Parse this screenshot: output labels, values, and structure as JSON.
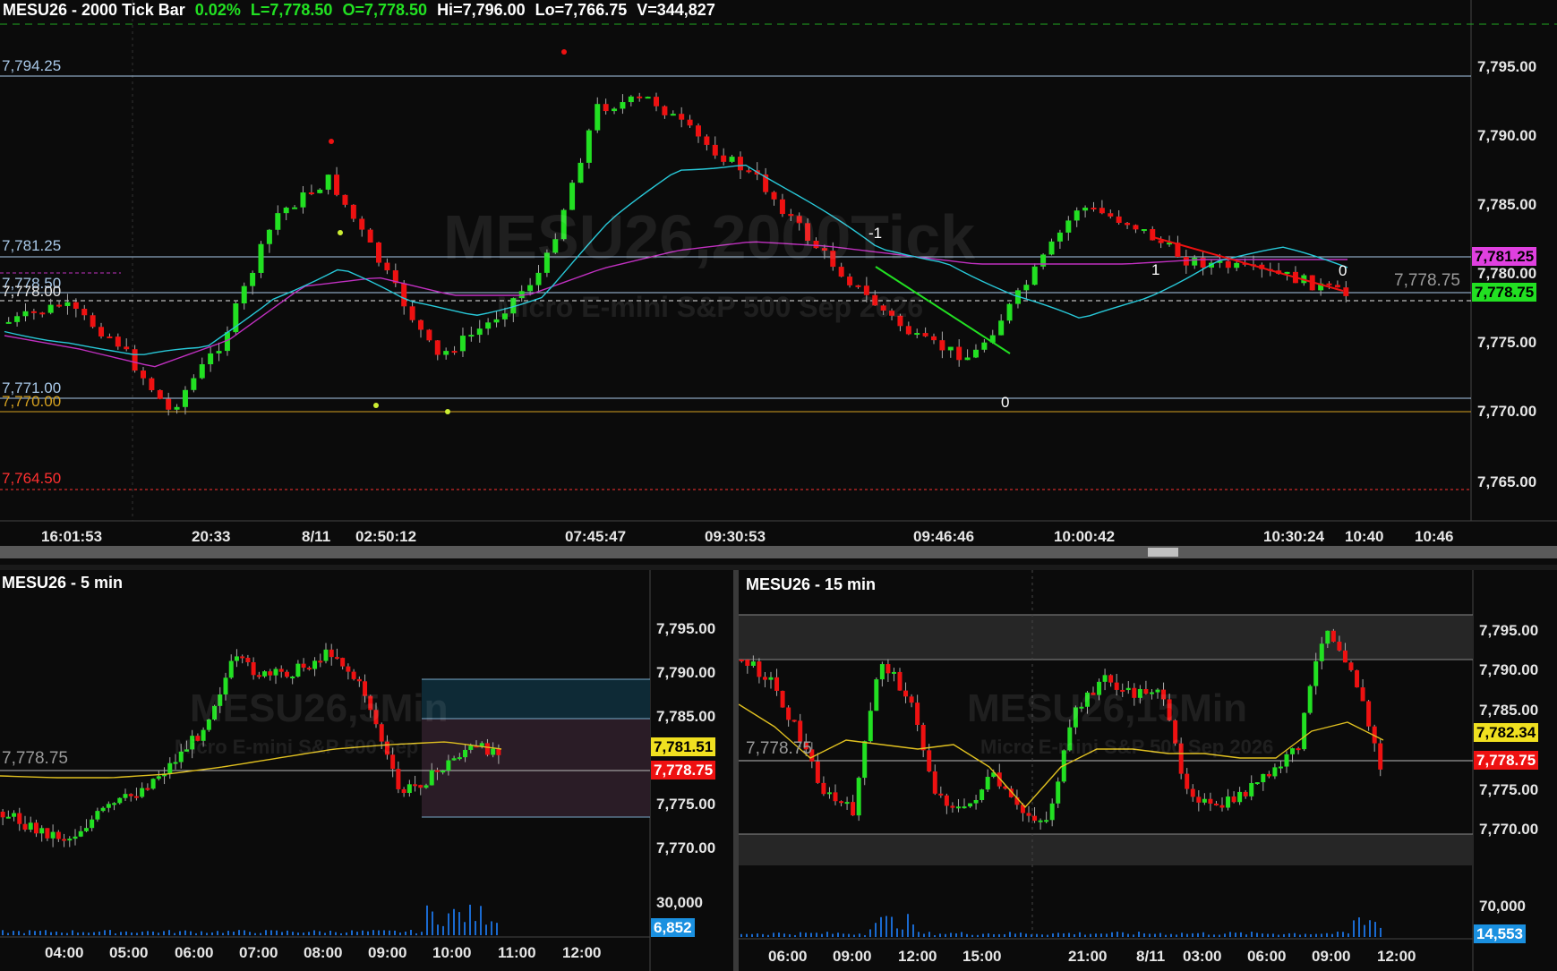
{
  "top": {
    "symbol_title": "MESU26 - 2000 Tick Bar",
    "change": "0.02%",
    "last": "L=7,778.50",
    "open": "O=7,778.50",
    "high": "Hi=7,796.00",
    "low": "Lo=7,766.75",
    "volume": "V=344,827",
    "watermark_main": "MESU26,2000Tick",
    "watermark_sub": "Micro E-mini S&P 500 Sep 2026",
    "price_axis": [
      "7,795.00",
      "7,790.00",
      "7,785.00",
      "7,780.00",
      "7,775.00",
      "7,770.00",
      "7,765.00"
    ],
    "time_axis": [
      "16:01:53",
      "20:33",
      "8/11",
      "02:50:12",
      "07:45:47",
      "09:30:53",
      "09:46:46",
      "10:00:42",
      "10:30:24",
      "10:40",
      "10:46"
    ],
    "levels": {
      "l1": "7,794.25",
      "l2": "7,781.25",
      "l3": "7,778.50",
      "l4": "7,778.00",
      "l5": "7,771.00",
      "l6": "7,770.00",
      "l7": "7,764.50"
    },
    "tags": {
      "purple": "7,781.25",
      "ghost": "7,778.75",
      "green": "7,778.75"
    },
    "annotations": {
      "a1": "-1",
      "a2": "0",
      "a3": "1",
      "a4": "0"
    },
    "colors": {
      "up": "#22e022",
      "down": "#ee1111",
      "fast_ma": "#28c8d8",
      "slow_ma": "#c030c0"
    }
  },
  "bottom_left": {
    "title": "MESU26 - 5 min",
    "watermark_main": "MESU26,5Min",
    "watermark_sub": "Micro E-mini S&P 500 Sep",
    "price_axis": [
      "7,795.00",
      "7,790.00",
      "7,785.00",
      "7,775.00",
      "7,770.00"
    ],
    "volume_axis": "30,000",
    "volume_tag": "6,852",
    "last_line_label": "7,778.75",
    "tag_yellow": "7,781.51",
    "tag_red": "7,778.75",
    "time_axis": [
      "04:00",
      "05:00",
      "06:00",
      "07:00",
      "08:00",
      "09:00",
      "10:00",
      "11:00",
      "12:00"
    ]
  },
  "bottom_right": {
    "title": "MESU26 - 15 min",
    "watermark_main": "MESU26,15Min",
    "watermark_sub": "Micro E-mini S&P 500 Sep 2026",
    "price_axis": [
      "7,795.00",
      "7,790.00",
      "7,785.00",
      "7,775.00",
      "7,770.00"
    ],
    "volume_axis": "70,000",
    "volume_tag": "14,553",
    "last_line_label": "7,778.75",
    "tag_yellow": "7,782.34",
    "tag_red": "7,778.75",
    "time_axis": [
      "06:00",
      "09:00",
      "12:00",
      "15:00",
      "21:00",
      "8/11",
      "03:00",
      "06:00",
      "09:00",
      "12:00"
    ]
  }
}
